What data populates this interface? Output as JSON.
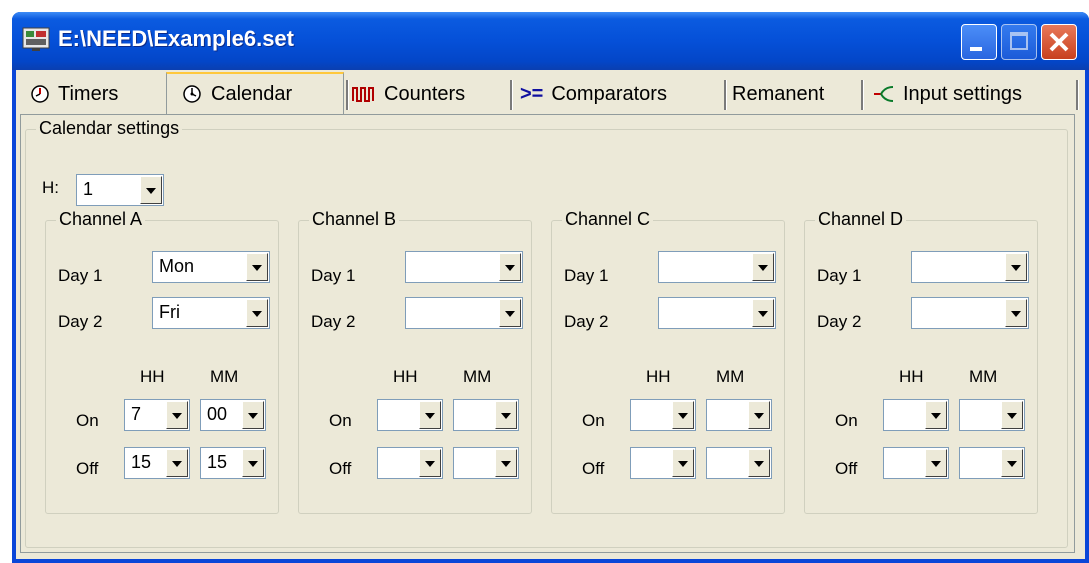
{
  "window": {
    "title": "E:\\NEED\\Example6.set"
  },
  "tabs": [
    {
      "label": "Timers",
      "icon": "clock-icon"
    },
    {
      "label": "Calendar",
      "icon": "calendar-clock-icon",
      "selected": true
    },
    {
      "label": "Counters",
      "icon": "pulse-counter-icon"
    },
    {
      "label": "Comparators",
      "icon": "comparator-icon",
      "symbol": ">="
    },
    {
      "label": "Remanent"
    },
    {
      "label": "Input settings",
      "icon": "input-branch-icon"
    }
  ],
  "calendar": {
    "group_label": "Calendar settings",
    "h_label": "H:",
    "h_value": "1",
    "day1_label": "Day 1",
    "day2_label": "Day 2",
    "hh_label": "HH",
    "mm_label": "MM",
    "on_label": "On",
    "off_label": "Off",
    "channels": [
      {
        "label": "Channel A",
        "day1": "Mon",
        "day2": "Fri",
        "on_hh": "7",
        "on_mm": "00",
        "off_hh": "15",
        "off_mm": "15"
      },
      {
        "label": "Channel B",
        "day1": "",
        "day2": "",
        "on_hh": "",
        "on_mm": "",
        "off_hh": "",
        "off_mm": ""
      },
      {
        "label": "Channel C",
        "day1": "",
        "day2": "",
        "on_hh": "",
        "on_mm": "",
        "off_hh": "",
        "off_mm": ""
      },
      {
        "label": "Channel D",
        "day1": "",
        "day2": "",
        "on_hh": "",
        "on_mm": "",
        "off_hh": "",
        "off_mm": ""
      }
    ]
  },
  "colors": {
    "titlebar": "#0550d8",
    "face": "#ece9d8",
    "selected_tab_accent": "#ffc83c",
    "close_button": "#c8401e"
  }
}
